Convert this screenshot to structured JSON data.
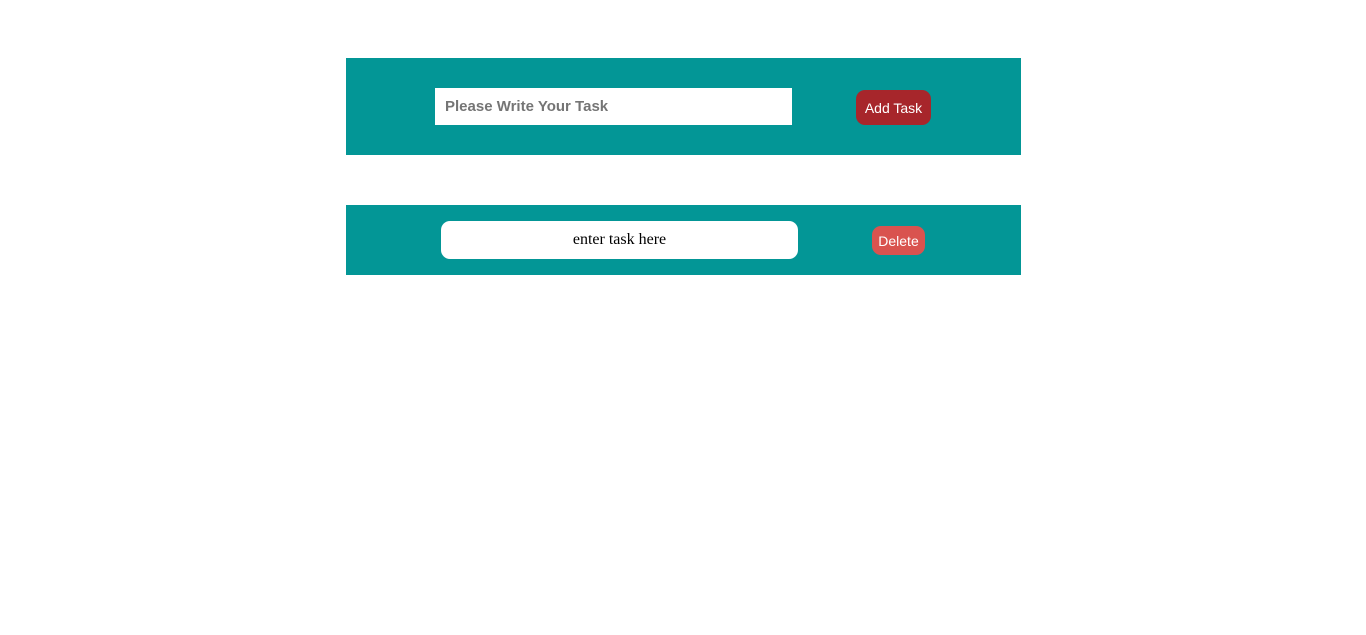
{
  "add_task": {
    "input_placeholder": "Please Write Your Task",
    "input_value": "",
    "button_label": "Add Task"
  },
  "tasks": [
    {
      "text": "enter task here",
      "delete_label": "Delete"
    }
  ],
  "colors": {
    "panel_background": "#039696",
    "add_button": "#a7262b",
    "delete_button": "#d9534f",
    "page_background": "#ffffff"
  }
}
